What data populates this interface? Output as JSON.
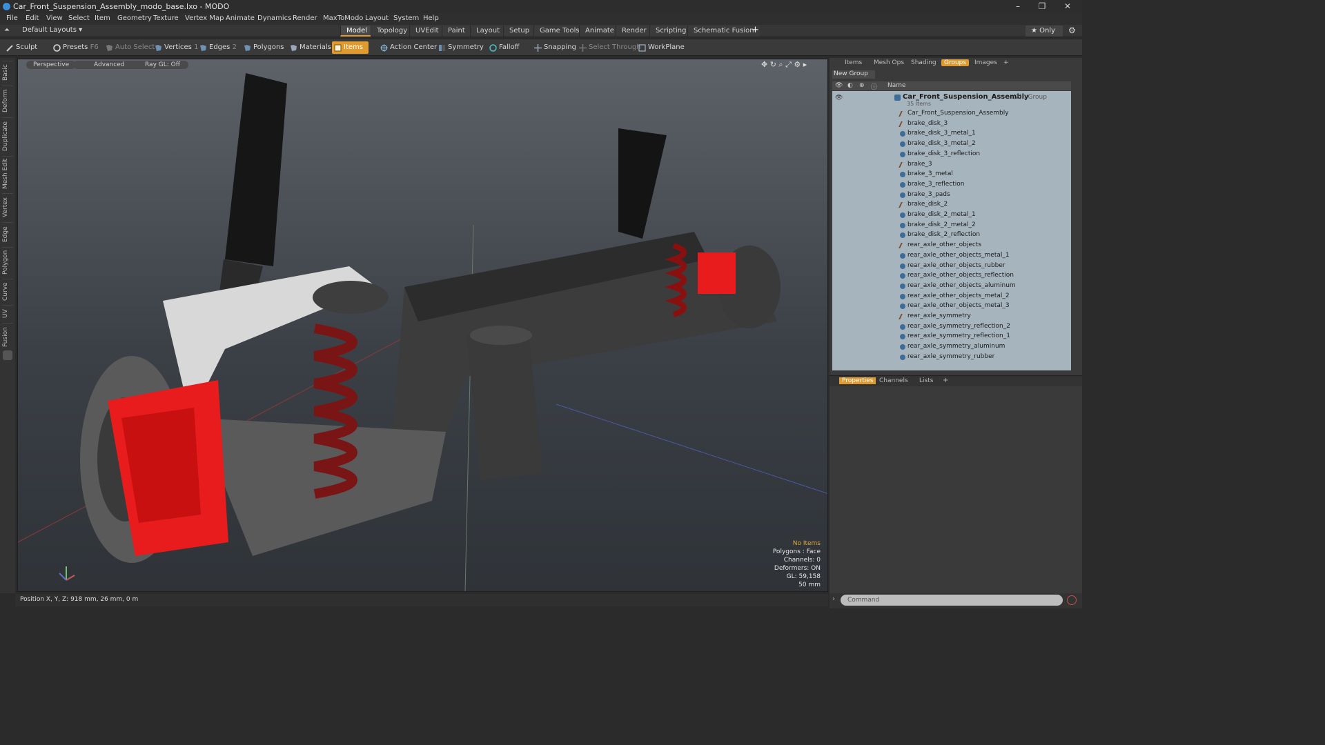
{
  "window": {
    "title": "Car_Front_Suspension_Assembly_modo_base.lxo - MODO",
    "controls": [
      "–",
      "❐",
      "✕"
    ]
  },
  "menu": [
    "File",
    "Edit",
    "View",
    "Select",
    "Item",
    "Geometry",
    "Texture",
    "Vertex Map",
    "Animate",
    "Dynamics",
    "Render",
    "MaxToModo",
    "Layout",
    "System",
    "Help"
  ],
  "layout": {
    "selector": "Default Layouts ▾",
    "tabs": [
      "Model",
      "Topology",
      "UVEdit",
      "Paint",
      "Layout",
      "Setup",
      "Game Tools",
      "Animate",
      "Render",
      "Scripting",
      "Schematic Fusion"
    ],
    "active_tab": "Model",
    "add_tab": "+",
    "only_label": "★  Only"
  },
  "toolbar": {
    "sculpt": "Sculpt",
    "presets": "Presets",
    "presets_key": "F6",
    "auto_select": "Auto Select",
    "vertices": "Vertices",
    "vertices_count": "1",
    "edges": "Edges",
    "edges_count": "2",
    "polygons": "Polygons",
    "materials": "Materials",
    "items": "Items",
    "action_center": "Action Center",
    "symmetry": "Symmetry",
    "falloff": "Falloff",
    "snapping": "Snapping",
    "select_through": "Select Through",
    "workplane": "WorkPlane"
  },
  "left_tabs": [
    "Basic",
    "Deform",
    "Duplicate",
    "Mesh Edit",
    "Vertex",
    "Edge",
    "Polygon",
    "Curve",
    "UV",
    "Fusion"
  ],
  "viewport": {
    "buttons": [
      "Perspective",
      "Advanced",
      "Ray GL: Off"
    ],
    "info": {
      "selection": "No Items",
      "polygons": "Polygons : Face",
      "channels": "Channels: 0",
      "deformers": "Deformers: ON",
      "gl": "GL: 59,158",
      "scale": "50 mm"
    }
  },
  "status": {
    "position": "Position X, Y, Z:   918 mm, 26 mm, 0 m"
  },
  "right_panel": {
    "tabs": [
      "Items",
      "Mesh Ops",
      "Shading",
      "Groups",
      "Images",
      "+"
    ],
    "active_tab": "Groups",
    "new_group": "New Group",
    "column_name": "Name",
    "group": {
      "name": "Car_Front_Suspension_Assembly",
      "suffix": "(2) : Group",
      "count": "35 Items"
    },
    "items": [
      "Car_Front_Suspension_Assembly",
      "brake_disk_3",
      "brake_disk_3_metal_1",
      "brake_disk_3_metal_2",
      "brake_disk_3_reflection",
      "brake_3",
      "brake_3_metal",
      "brake_3_reflection",
      "brake_3_pads",
      "brake_disk_2",
      "brake_disk_2_metal_1",
      "brake_disk_2_metal_2",
      "brake_disk_2_reflection",
      "rear_axle_other_objects",
      "rear_axle_other_objects_metal_1",
      "rear_axle_other_objects_rubber",
      "rear_axle_other_objects_reflection",
      "rear_axle_other_objects_aluminum",
      "rear_axle_other_objects_metal_2",
      "rear_axle_other_objects_metal_3",
      "rear_axle_symmetry",
      "rear_axle_symmetry_reflection_2",
      "rear_axle_symmetry_reflection_1",
      "rear_axle_symmetry_aluminum",
      "rear_axle_symmetry_rubber"
    ],
    "item_kinds": [
      "loc",
      "loc",
      "mesh",
      "mesh",
      "mesh",
      "loc",
      "mesh",
      "mesh",
      "mesh",
      "loc",
      "mesh",
      "mesh",
      "mesh",
      "loc",
      "mesh",
      "mesh",
      "mesh",
      "mesh",
      "mesh",
      "mesh",
      "loc",
      "mesh",
      "mesh",
      "mesh",
      "mesh"
    ],
    "bottom_tabs": [
      "Properties",
      "Channels",
      "Lists",
      "+"
    ],
    "active_bottom_tab": "Properties",
    "command_placeholder": "Command"
  },
  "colors": {
    "accent": "#e09a2d",
    "list_bg": "#a6b4bd",
    "caliper_red": "#e81c1c"
  }
}
